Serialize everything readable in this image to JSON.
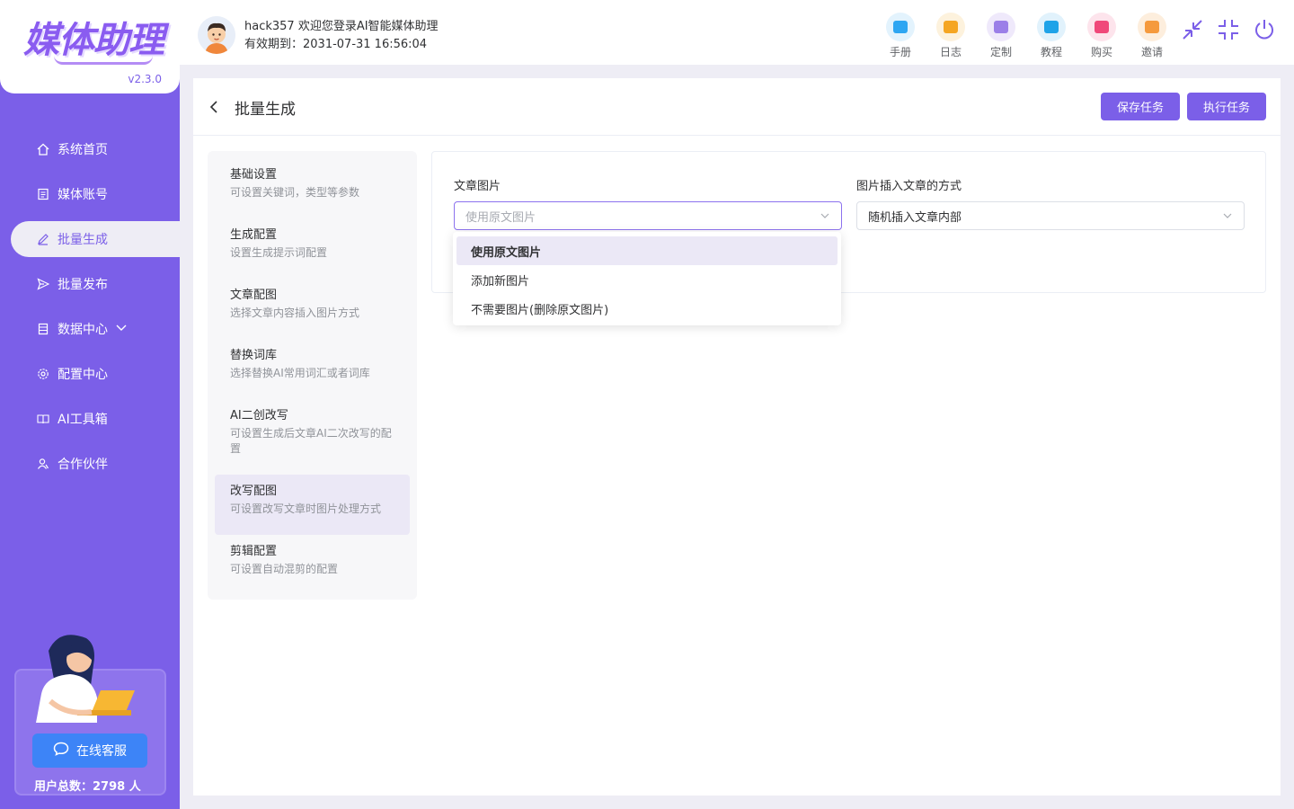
{
  "app": {
    "logo_text": "媒体助理",
    "version": "v2.3.0"
  },
  "sidebar": {
    "items": [
      {
        "label": "系统首页",
        "icon": "home-icon"
      },
      {
        "label": "媒体账号",
        "icon": "account-icon"
      },
      {
        "label": "批量生成",
        "icon": "edit-icon",
        "active": true
      },
      {
        "label": "批量发布",
        "icon": "send-icon"
      },
      {
        "label": "数据中心",
        "icon": "data-icon",
        "has_submenu": true
      },
      {
        "label": "配置中心",
        "icon": "gear-icon"
      },
      {
        "label": "AI工具箱",
        "icon": "book-icon"
      },
      {
        "label": "合作伙伴",
        "icon": "partner-icon"
      }
    ],
    "support_button": "在线客服",
    "user_count": "用户总数：2798 人"
  },
  "header": {
    "welcome": "hack357 欢迎您登录AI智能媒体助理",
    "expiry": "有效期到：2031-07-31 16:56:04",
    "tools": [
      {
        "label": "手册",
        "color": "#2ea6f2"
      },
      {
        "label": "日志",
        "color": "#f5a623"
      },
      {
        "label": "定制",
        "color": "#9b7fe8"
      },
      {
        "label": "教程",
        "color": "#1fa3e8"
      },
      {
        "label": "购买",
        "color": "#f0487a"
      },
      {
        "label": "邀请",
        "color": "#f59a3d"
      }
    ]
  },
  "page": {
    "title": "批量生成",
    "save_label": "保存任务",
    "run_label": "执行任务"
  },
  "steps": [
    {
      "title": "基础设置",
      "desc": "可设置关键词，类型等参数"
    },
    {
      "title": "生成配置",
      "desc": "设置生成提示词配置"
    },
    {
      "title": "文章配图",
      "desc": "选择文章内容插入图片方式"
    },
    {
      "title": "替换词库",
      "desc": "选择替换AI常用词汇或者词库"
    },
    {
      "title": "AI二创改写",
      "desc": "可设置生成后文章AI二次改写的配置"
    },
    {
      "title": "改写配图",
      "desc": "可设置改写文章时图片处理方式",
      "active": true
    },
    {
      "title": "剪辑配置",
      "desc": "可设置自动混剪的配置"
    }
  ],
  "form": {
    "image_label": "文章图片",
    "image_placeholder": "使用原文图片",
    "insert_label": "图片插入文章的方式",
    "insert_value": "随机插入文章内部"
  },
  "dropdown": {
    "options": [
      "使用原文图片",
      "添加新图片",
      "不需要图片(删除原文图片)"
    ],
    "selected_index": 0
  },
  "colors": {
    "accent": "#7b5fe8",
    "support_button": "#3d84f7"
  }
}
